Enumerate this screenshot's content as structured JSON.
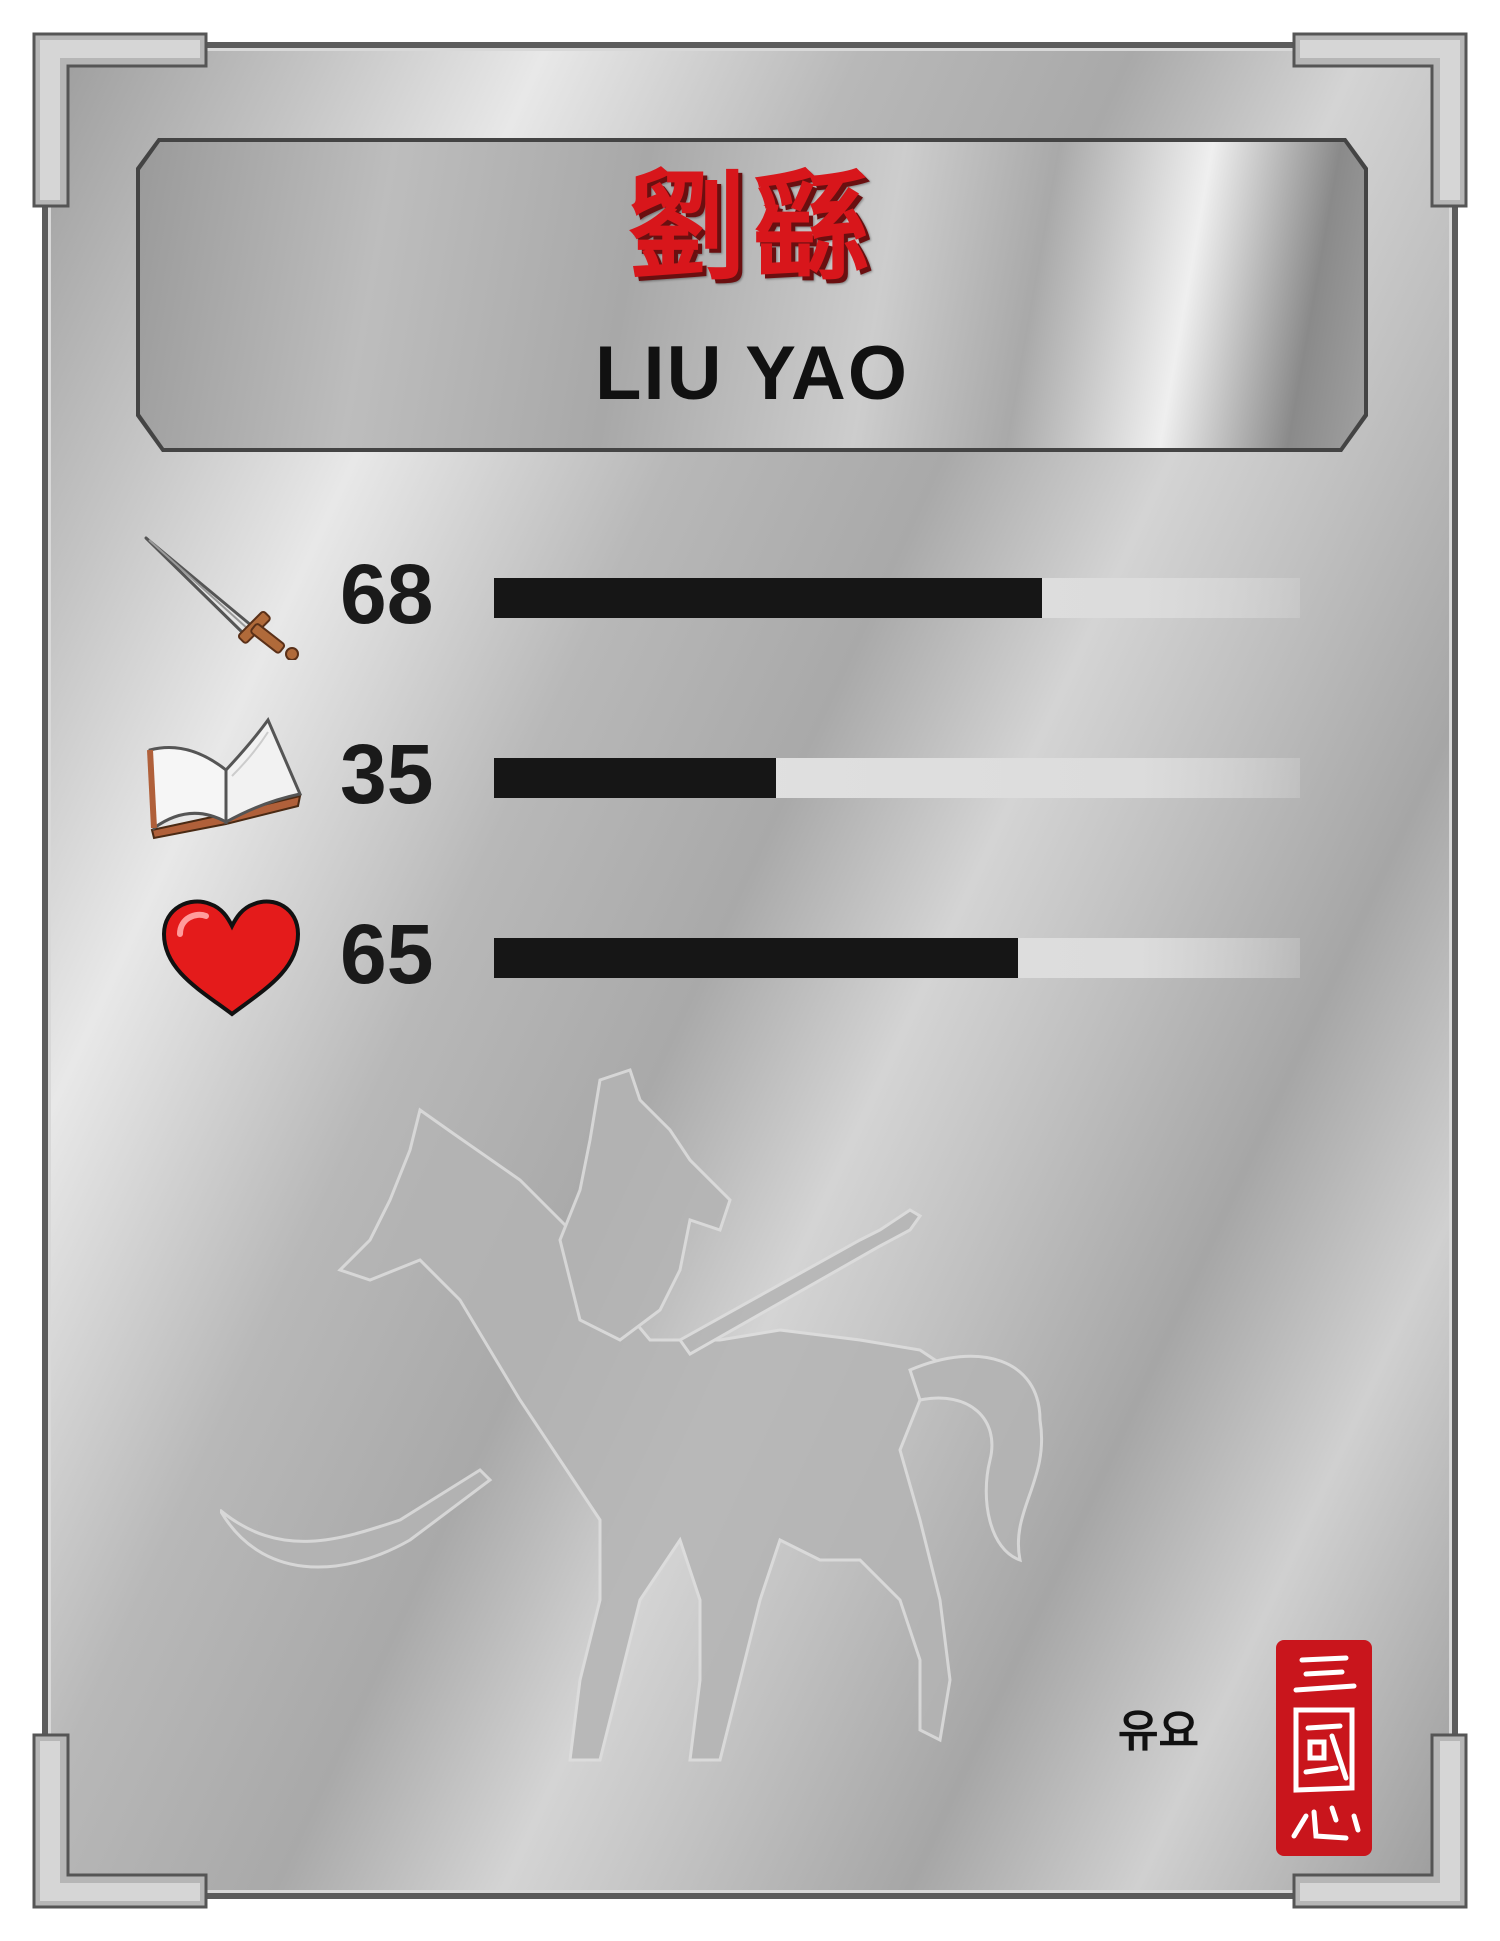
{
  "card": {
    "name_chinese": "劉繇",
    "name_english": "LIU YAO",
    "name_korean": "유요",
    "seal_text": "三國志"
  },
  "stats": [
    {
      "icon": "sword-icon",
      "label": "68",
      "value": 68,
      "max": 100
    },
    {
      "icon": "book-icon",
      "label": "35",
      "value": 35,
      "max": 100
    },
    {
      "icon": "heart-icon",
      "label": "65",
      "value": 65,
      "max": 100
    }
  ],
  "colors": {
    "name_red": "#d8161b",
    "bar_fill": "#161616",
    "bar_track": "#e2e2e2",
    "seal_red": "#c9151c"
  }
}
